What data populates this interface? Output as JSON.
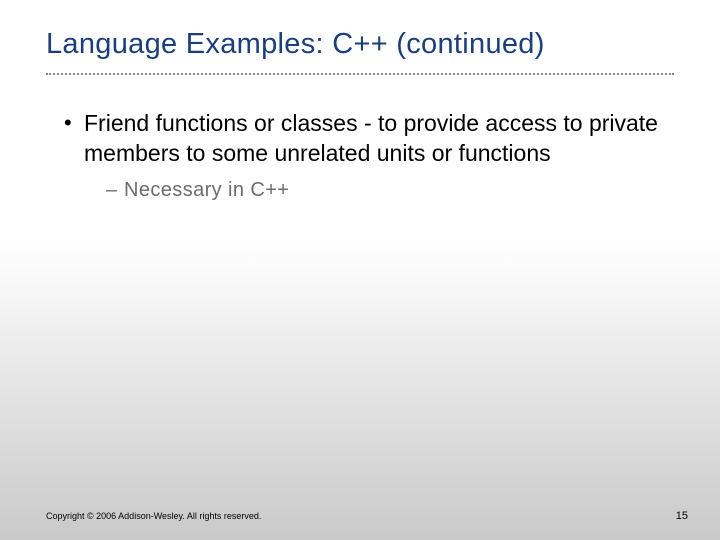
{
  "title": "Language Examples: C++ (continued)",
  "bullets": [
    {
      "text": "Friend functions or classes - to provide access to private members to some unrelated units or functions",
      "sub": [
        "Necessary in C++"
      ]
    }
  ],
  "footer": {
    "copyright": "Copyright © 2006 Addison-Wesley. All rights reserved.",
    "page": "15"
  }
}
